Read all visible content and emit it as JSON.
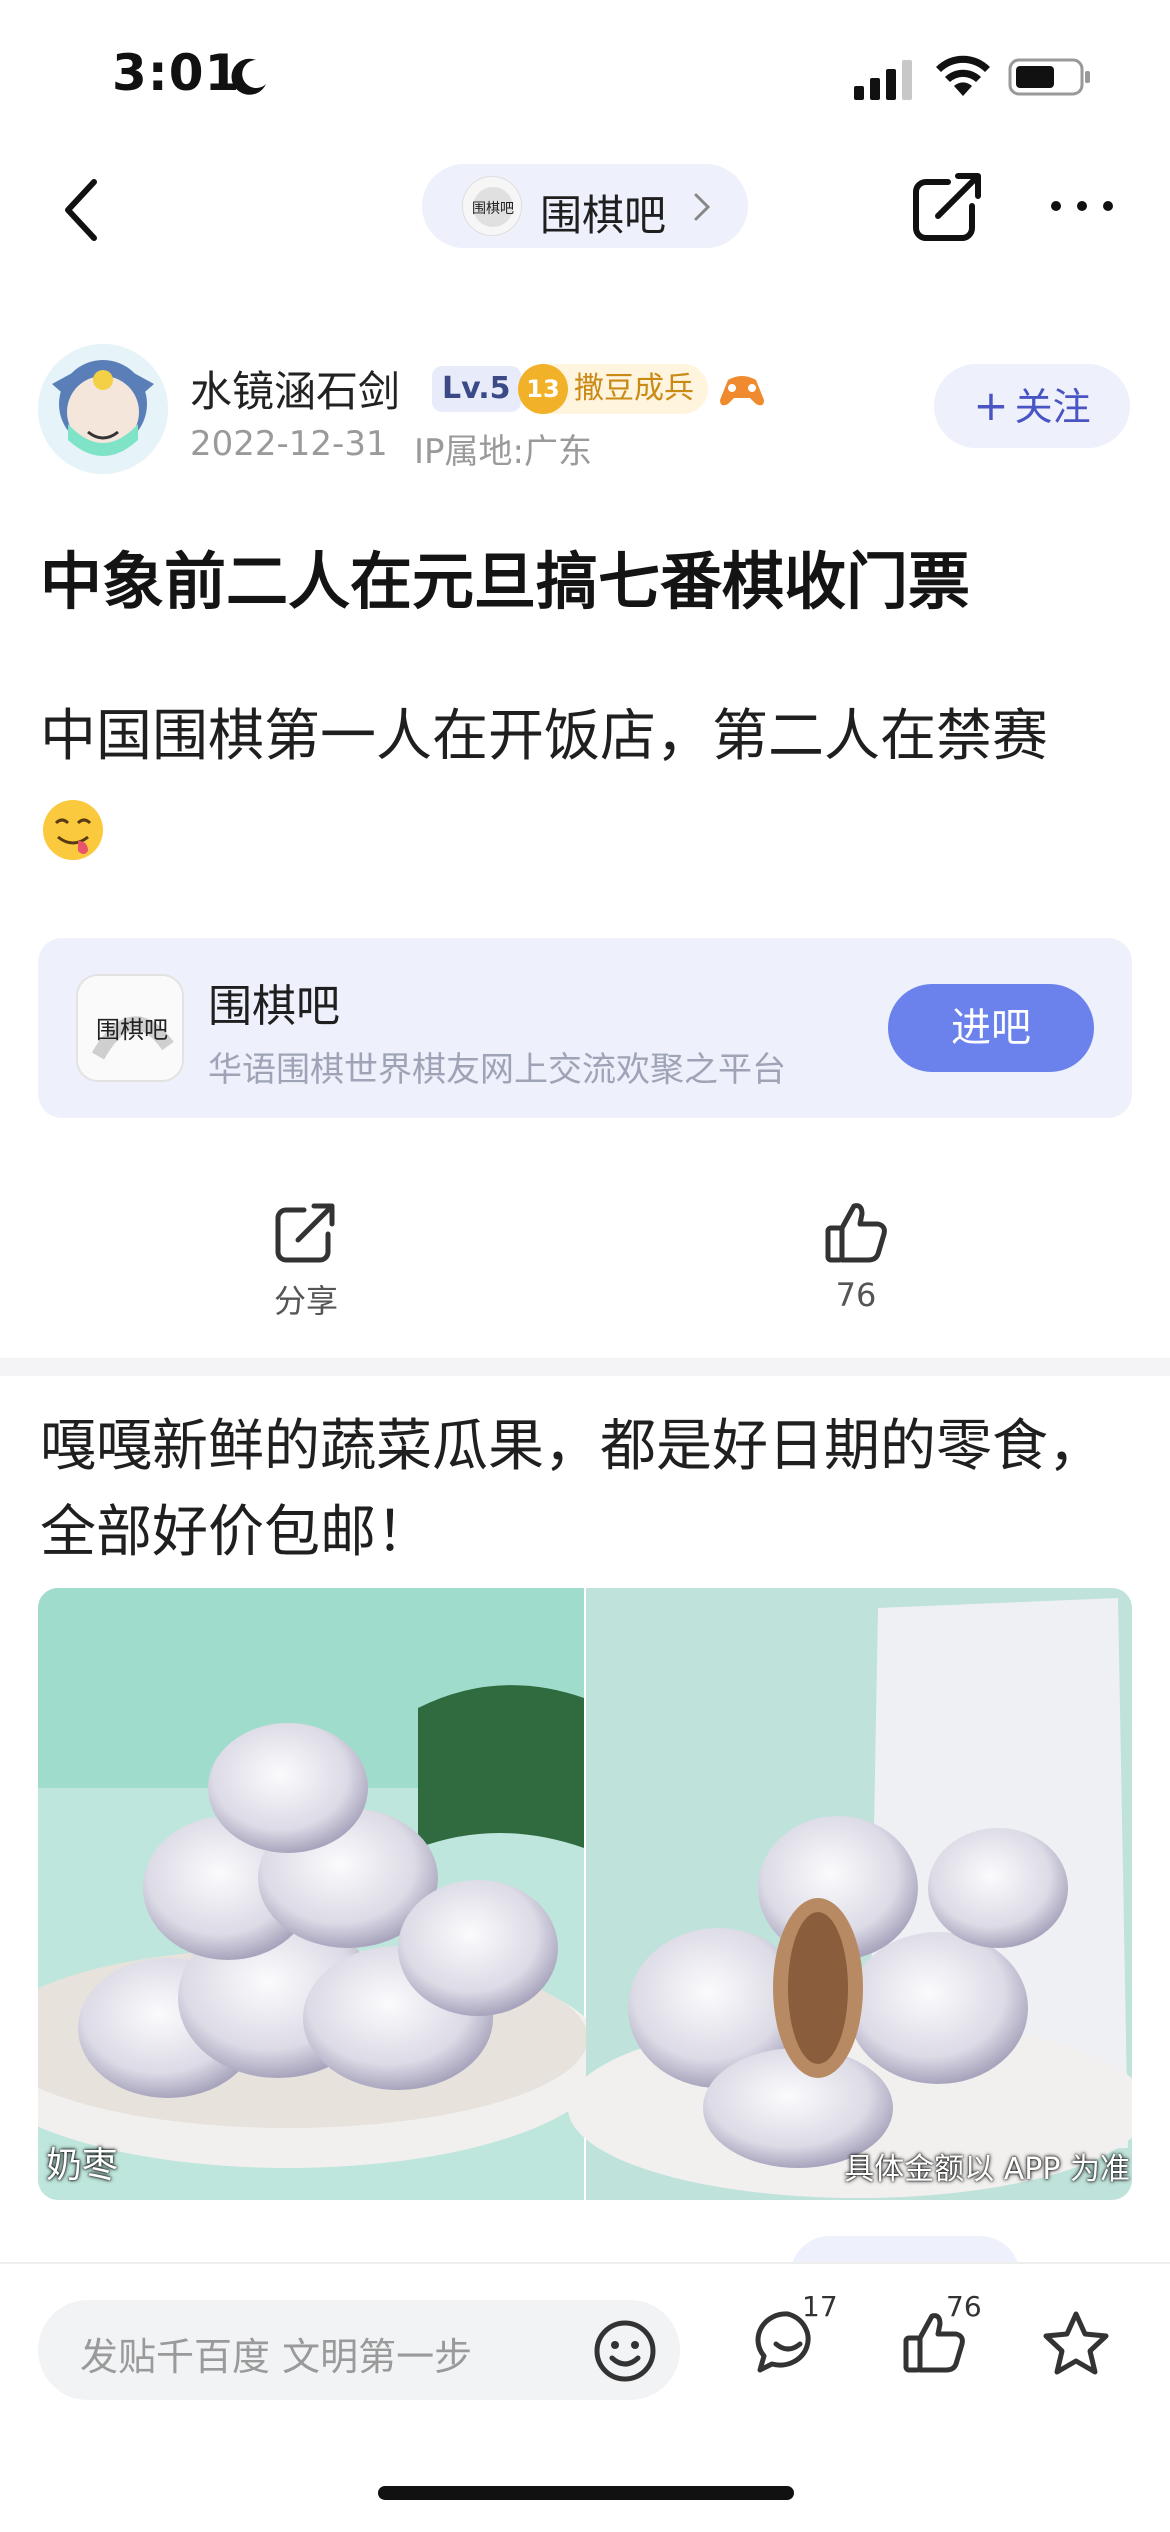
{
  "status_bar": {
    "time": "3:01"
  },
  "nav": {
    "forum_name": "围棋吧",
    "forum_avatar_text": "围棋吧"
  },
  "author": {
    "name": "水镜涵石剑",
    "level": "Lv.5",
    "rank_level": "13",
    "rank_title": "撒豆成兵",
    "date": "2022-12-31",
    "ip": "IP属地:广东",
    "follow_label": "关注"
  },
  "post": {
    "title": "中象前二人在元旦搞七番棋收门票",
    "body": "中国围棋第一人在开饭店，第二人在禁赛"
  },
  "forum_card": {
    "name": "围棋吧",
    "description": "华语围棋世界棋友网上交流欢聚之平台",
    "enter_label": "进吧",
    "avatar_text": "围棋吧"
  },
  "actions": {
    "share_label": "分享",
    "like_count": "76"
  },
  "ad": {
    "title": "嘎嘎新鲜的蔬菜瓜果，都是好日期的零食，全部好价包邮！",
    "caption_left": "奶枣",
    "caption_right": "具体金额以 APP 为准"
  },
  "bottom_bar": {
    "reply_placeholder": "发贴千百度 文明第一步",
    "comment_count": "17",
    "like_count": "76"
  },
  "colors": {
    "accent": "#6b82ec",
    "card_bg": "#eef0fb",
    "follow_text": "#4a55c4"
  }
}
